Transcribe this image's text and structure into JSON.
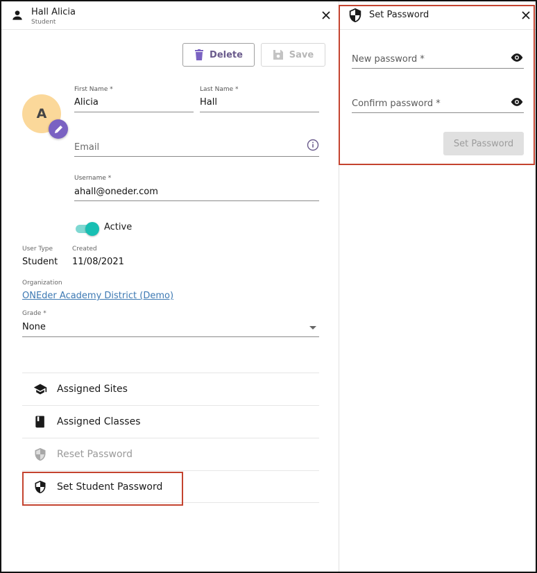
{
  "user_panel": {
    "header": {
      "title": "Hall Alicia",
      "subtitle": "Student"
    },
    "toolbar": {
      "delete_label": "Delete",
      "save_label": "Save"
    },
    "avatar": {
      "initial": "A"
    },
    "first_name": {
      "label": "First Name *",
      "value": "Alicia"
    },
    "last_name": {
      "label": "Last Name *",
      "value": "Hall"
    },
    "email": {
      "placeholder": "Email"
    },
    "username": {
      "label": "Username *",
      "value": "ahall@oneder.com"
    },
    "active": {
      "label": "Active",
      "on": true
    },
    "user_type": {
      "label": "User Type",
      "value": "Student"
    },
    "created": {
      "label": "Created",
      "value": "11/08/2021"
    },
    "organization": {
      "label": "Organization",
      "value": "ONEder Academy District (Demo)"
    },
    "grade": {
      "label": "Grade *",
      "value": "None"
    },
    "menu": [
      {
        "label": "Assigned Sites",
        "icon": "school-icon",
        "disabled": false
      },
      {
        "label": "Assigned Classes",
        "icon": "book-icon",
        "disabled": false
      },
      {
        "label": "Reset Password",
        "icon": "shield-icon",
        "disabled": true
      },
      {
        "label": "Set Student Password",
        "icon": "shield-icon",
        "disabled": false
      }
    ]
  },
  "password_panel": {
    "header": {
      "title": "Set Password"
    },
    "new_password": {
      "placeholder": "New password *"
    },
    "confirm_password": {
      "placeholder": "Confirm password *"
    },
    "submit_label": "Set Password"
  },
  "colors": {
    "accent_purple": "#7a62c2",
    "toggle_teal": "#18bfb3",
    "avatar_bg": "#fbd89a",
    "link_blue": "#3d79b3",
    "highlight_red": "#c4432f"
  }
}
